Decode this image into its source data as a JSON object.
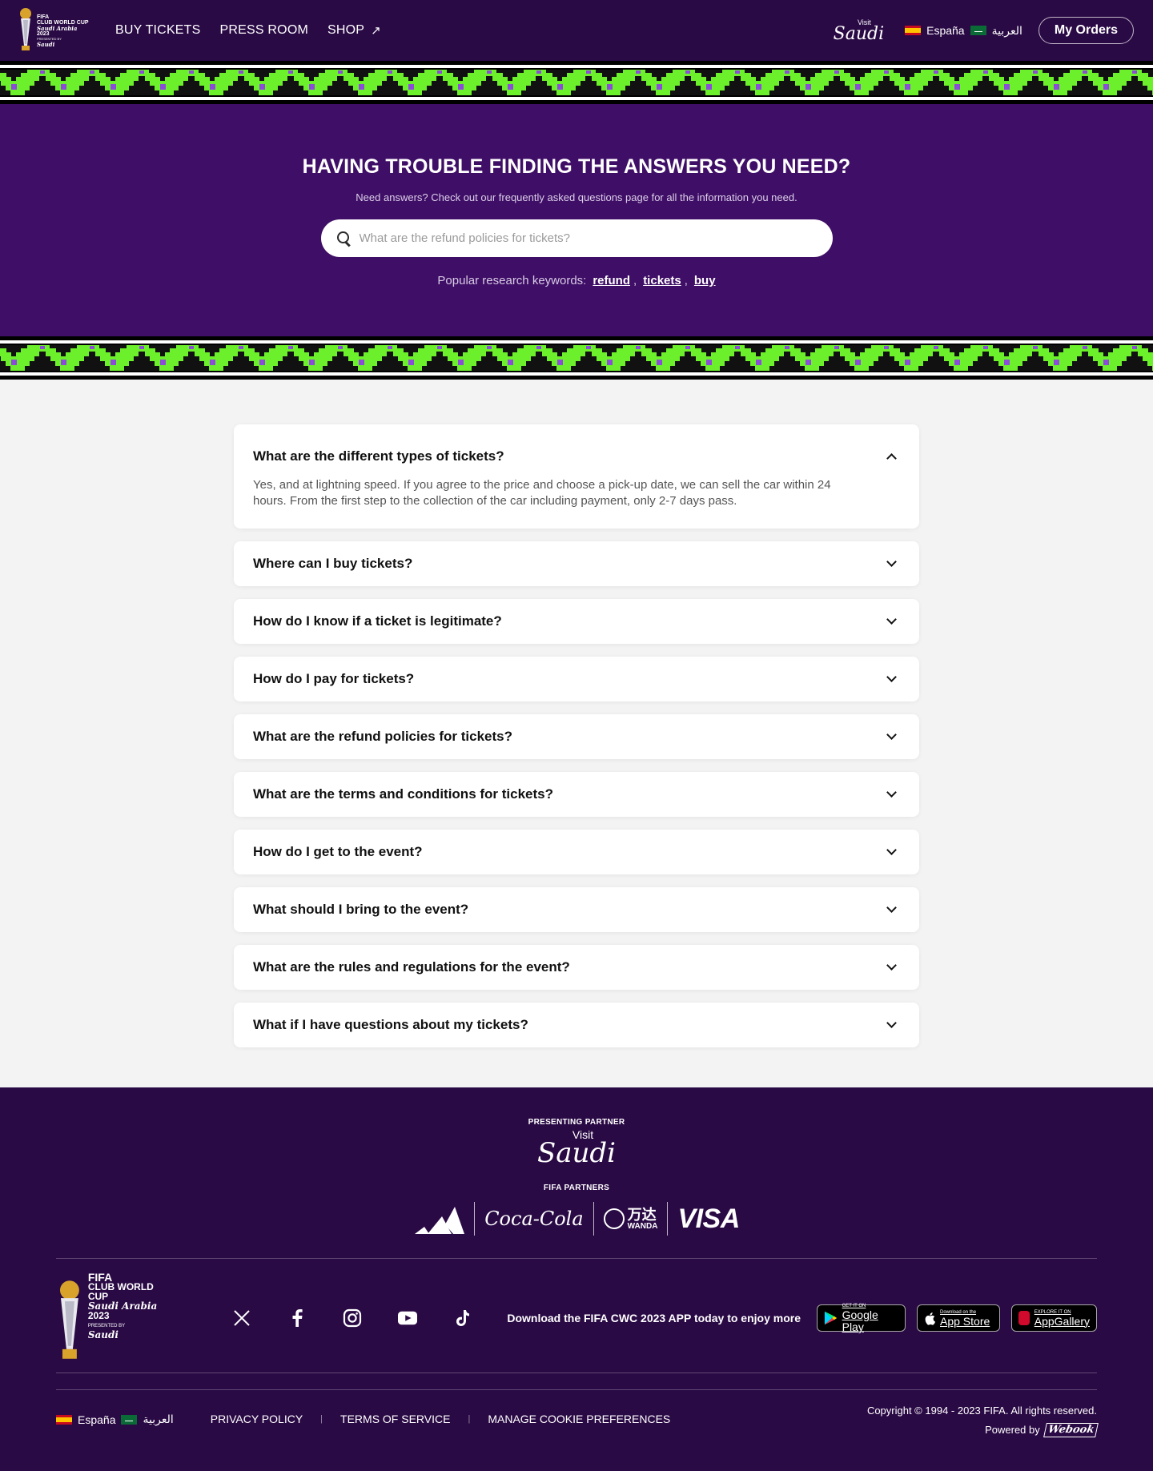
{
  "header": {
    "logo": {
      "line1": "FIFA",
      "line2": "CLUB WORLD CUP",
      "line3": "Saudi Arabia",
      "line4": "2023",
      "line5": "PRESENTED BY",
      "line6": "Saudi"
    },
    "nav": [
      {
        "label": "BUY TICKETS"
      },
      {
        "label": "PRESS ROOM"
      },
      {
        "label": "SHOP"
      }
    ],
    "shop_icon": "↗",
    "visit_saudi": {
      "visit": "Visit",
      "saudi": "Saudi"
    },
    "lang_es": "España",
    "lang_ar": "العربية",
    "my_orders": "My Orders"
  },
  "hero": {
    "title": "HAVING TROUBLE FINDING THE ANSWERS YOU NEED?",
    "subtitle": "Need answers? Check out our frequently asked questions page for all the information you need.",
    "search_placeholder": "What are the refund policies for tickets?",
    "keywords_label": "Popular research keywords:",
    "keywords": [
      "refund",
      "tickets",
      "buy"
    ]
  },
  "faq": [
    {
      "question": "What are the different types of tickets?",
      "answer": "Yes, and at lightning speed. If you agree to the price and choose a pick-up date, we can sell the car within 24 hours. From the first step to the collection of the car including payment, only 2-7 days pass.",
      "open": true
    },
    {
      "question": "Where can I buy tickets?"
    },
    {
      "question": "How do I know if a ticket is legitimate?"
    },
    {
      "question": "How do I pay for tickets?"
    },
    {
      "question": "What are the refund policies for tickets?"
    },
    {
      "question": "What are the terms and conditions for tickets?"
    },
    {
      "question": "How do I get to the event?"
    },
    {
      "question": "What should I bring to the event?"
    },
    {
      "question": "What are the rules and regulations for the event?"
    },
    {
      "question": "What if I have questions about my tickets?"
    }
  ],
  "footer": {
    "presenting_partner": "PRESENTING PARTNER",
    "visit_saudi": {
      "visit": "Visit",
      "saudi": "Saudi"
    },
    "fifa_partners": "FIFA PARTNERS",
    "partners": {
      "cocacola": "Coca-Cola",
      "wanda_cn": "万达",
      "wanda": "WANDA",
      "visa": "VISA"
    },
    "logo": {
      "line1": "FIFA",
      "line2": "CLUB WORLD CUP",
      "line3": "Saudi Arabia",
      "line4": "2023",
      "line5": "PRESENTED BY",
      "line6": "Saudi"
    },
    "socials": [
      "x-icon",
      "facebook-icon",
      "instagram-icon",
      "youtube-icon",
      "tiktok-icon"
    ],
    "app_text": "Download the FIFA CWC 2023 APP today to enjoy more",
    "stores": {
      "google_small": "GET IT ON",
      "google": "Google Play",
      "apple_small": "Download on the",
      "apple": "App Store",
      "huawei_small": "EXPLORE IT ON",
      "huawei": "AppGallery"
    },
    "lang_es": "España",
    "lang_ar": "العربية",
    "links": [
      "PRIVACY POLICY",
      "TERMS OF SERVICE",
      "MANAGE COOKIE PREFERENCES"
    ],
    "copyright": "Copyright © 1994 - 2023 FIFA. All rights reserved.",
    "powered_by": "Powered by",
    "powered_logo": "Webook"
  },
  "colors": {
    "header_bg": "#2a0a45",
    "hero_bg": "#3f0e66",
    "band_green": "#6cf02b",
    "band_purple": "#8b4dd8",
    "page_bg": "#f3f3f3"
  }
}
